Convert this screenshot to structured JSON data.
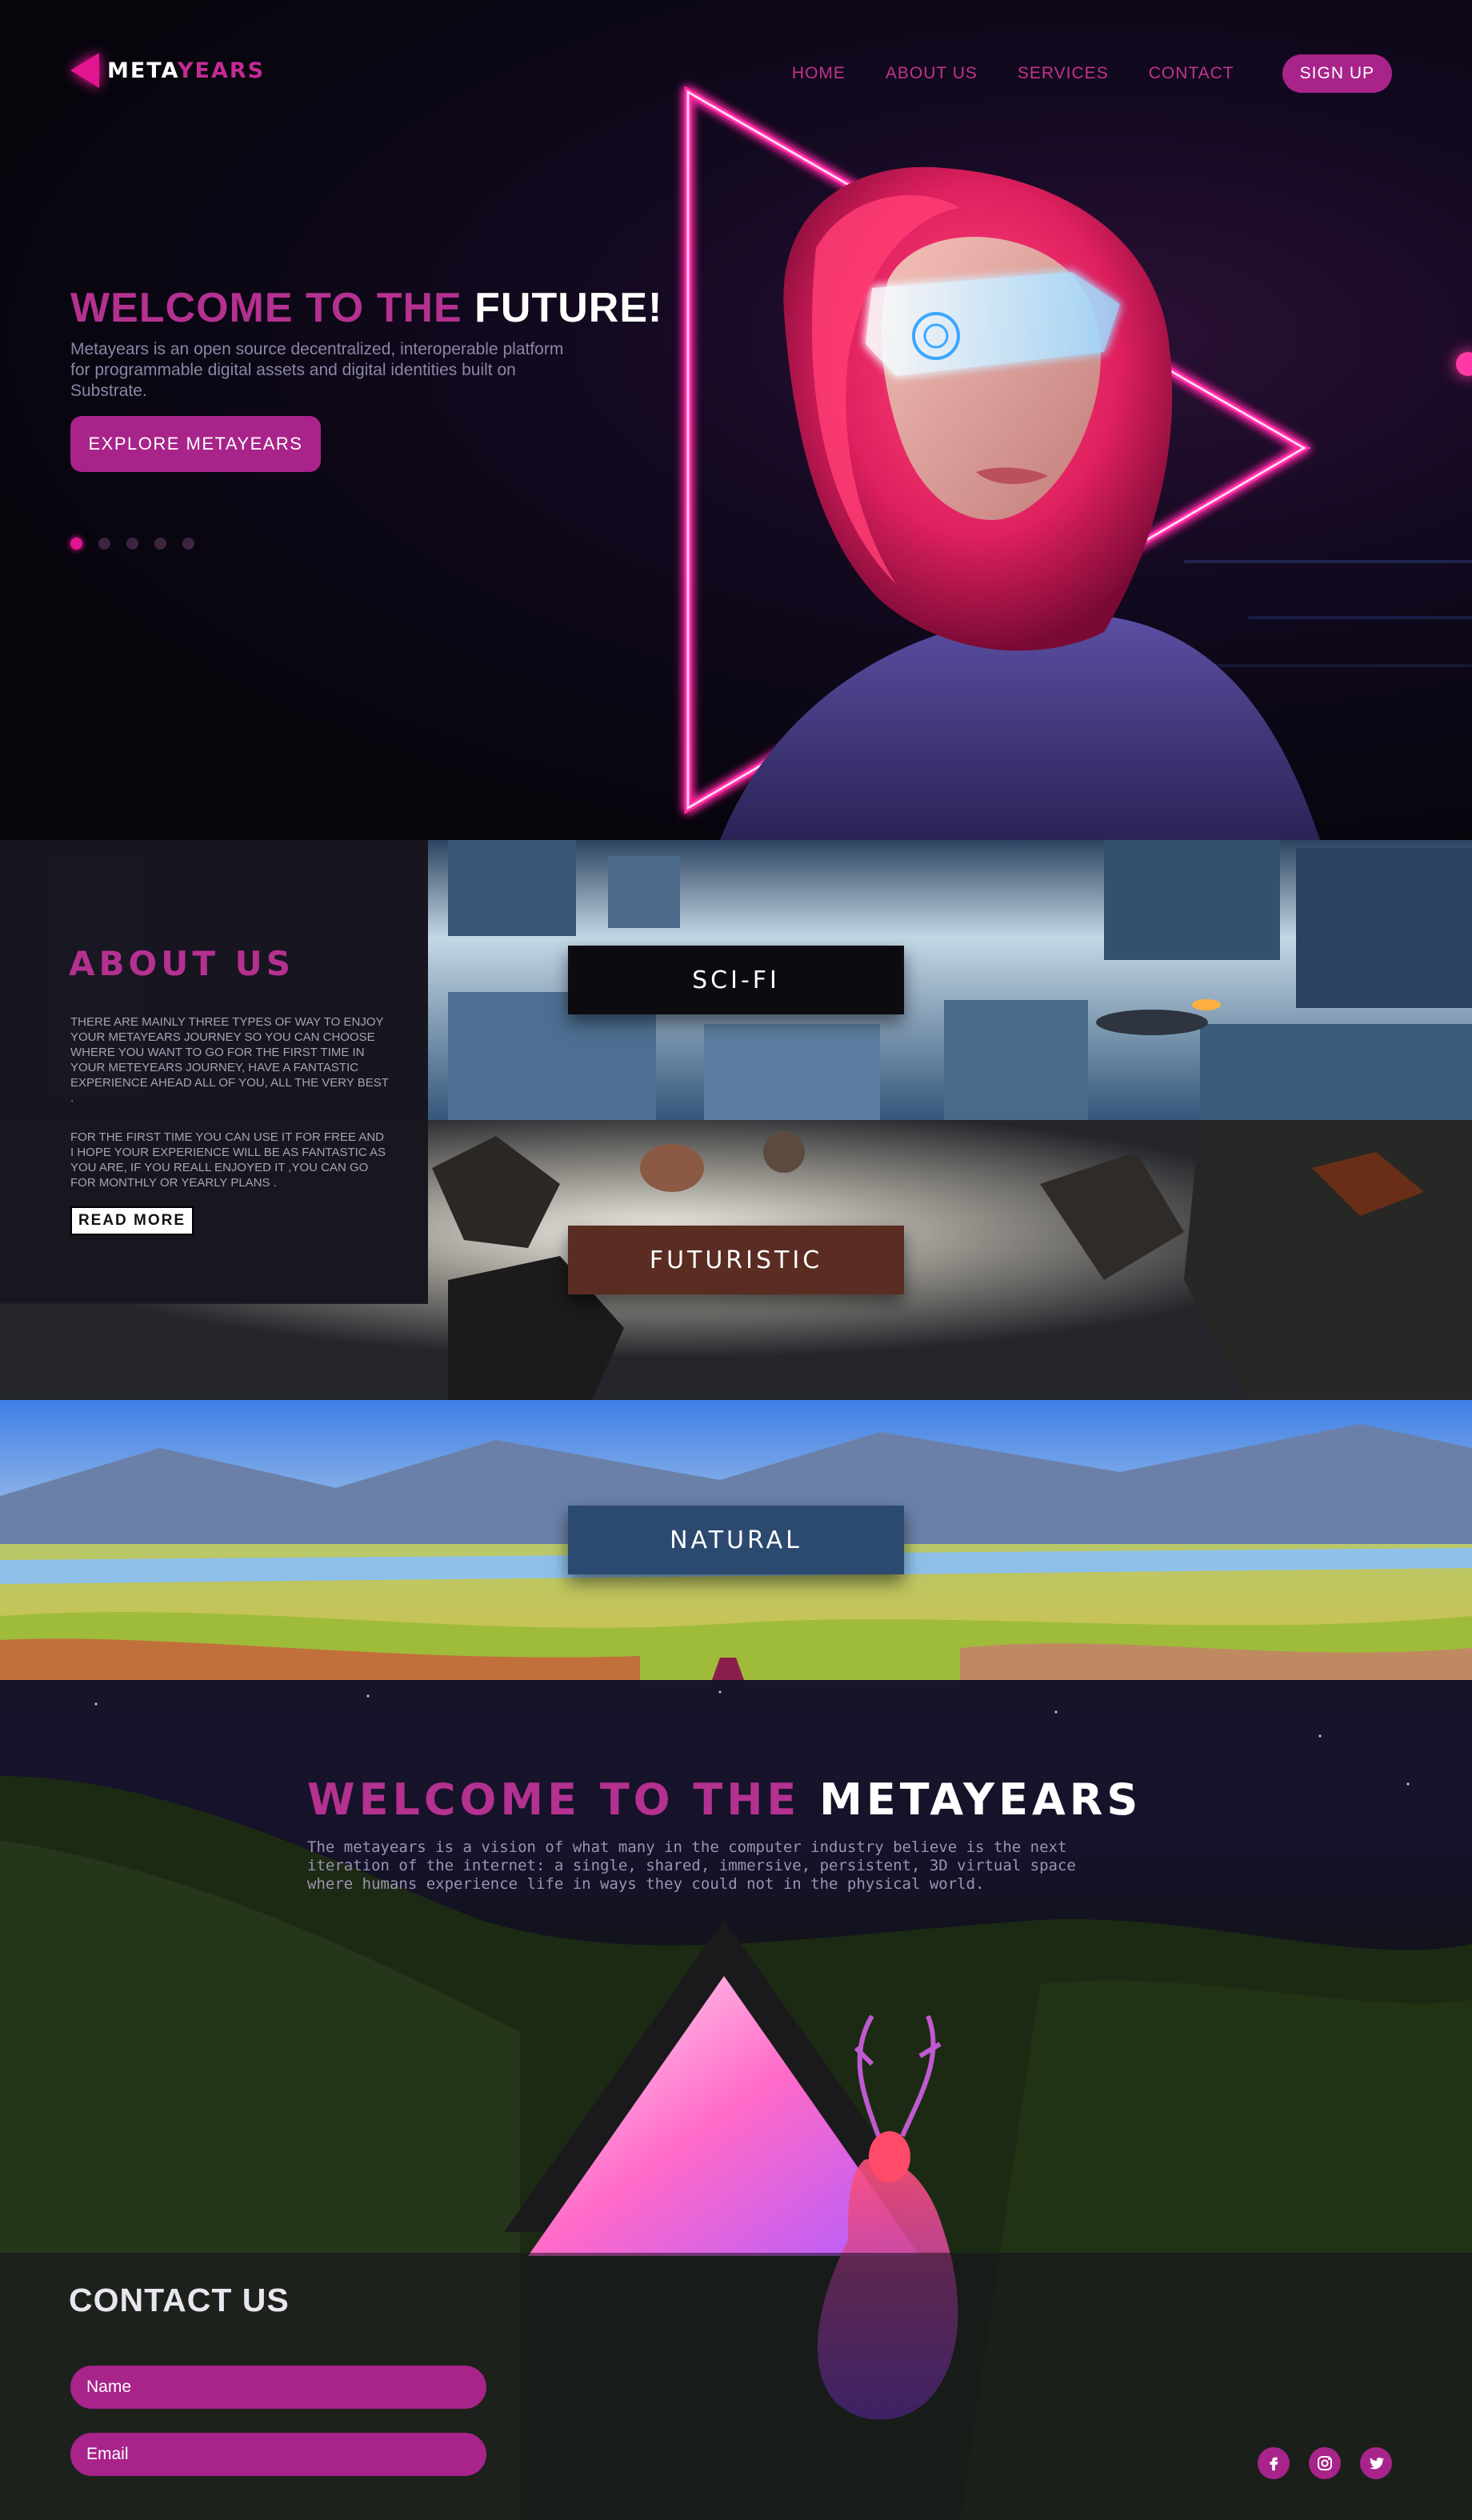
{
  "brand": {
    "logo_part1": "META",
    "logo_part2": "YEARS"
  },
  "nav": {
    "items": [
      "HOME",
      "ABOUT US",
      "SERVICES",
      "CONTACT"
    ],
    "signup_label": "SIGN UP"
  },
  "hero": {
    "title_part1": "WELCOME TO THE ",
    "title_part2": "FUTURE!",
    "description": "Metayears is an open source decentralized, interoperable platform for programmable digital assets and digital identities built on Substrate.",
    "cta_label": "EXPLORE METAYEARS",
    "slide_count": 5,
    "active_slide": 1
  },
  "about": {
    "title": "ABOUT US",
    "paragraph1": "There are mainly three types of way to enjoy your metayears journey so you can choose where you want to go for the first time in your meteyears journey, have a fantastic experience ahead all of you, all the very best .",
    "paragraph2": "For the first time you can use it for free and I hope your experience will be as fantastic as you are, if you reall enjoyed it ,you can go for monthly or yearly plans .",
    "read_more_label": "READ MORE"
  },
  "genres": [
    {
      "label": "SCI-FI",
      "button_color": "#0c0c10"
    },
    {
      "label": "FUTURISTIC",
      "button_color": "#5a2c22"
    },
    {
      "label": "NATURAL",
      "button_color": "#2c4a70"
    }
  ],
  "welcome": {
    "title_part1": "WELCOME TO THE ",
    "title_part2": "METAYEARS",
    "description": "The metayears is a vision of what many in the computer industry believe is the next iteration of the internet: a single, shared, immersive, persistent, 3D virtual space where humans experience life in ways they could not in the physical world."
  },
  "contact": {
    "title": "CONTACT US",
    "name_placeholder": "Name",
    "email_placeholder": "Email",
    "socials": [
      "facebook-icon",
      "instagram-icon",
      "twitter-icon"
    ]
  },
  "colors": {
    "accent": "#a8238a",
    "accent_glow": "#e0158f",
    "accent_text": "#b43190",
    "background": "#07060f"
  }
}
